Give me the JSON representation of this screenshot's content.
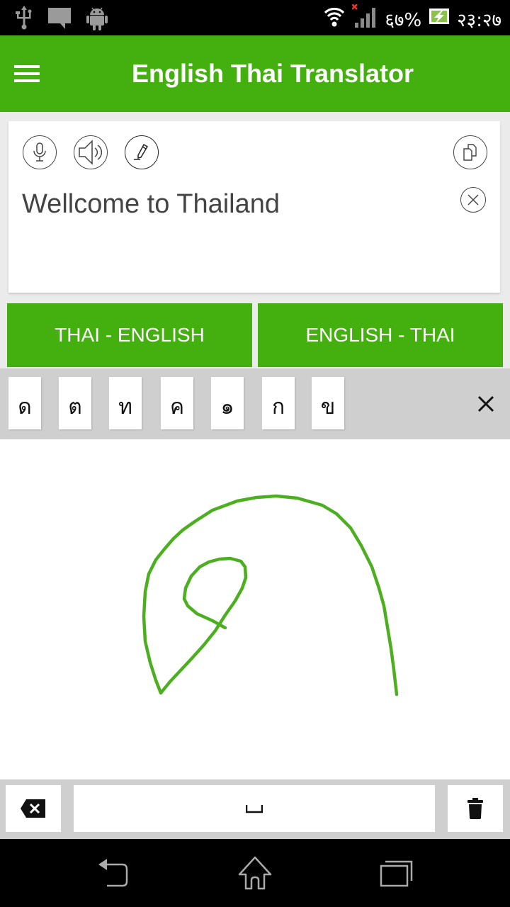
{
  "status_bar": {
    "battery_percent": "६७%",
    "time": "२३:२७",
    "icons": [
      "usb-icon",
      "message-icon",
      "android-icon",
      "wifi-icon",
      "signal-icon",
      "battery-charging-icon"
    ]
  },
  "app_bar": {
    "title": "English Thai Translator",
    "menu_icon": "hamburger-menu-icon"
  },
  "input": {
    "text": "Wellcome to Thailand",
    "actions": [
      "microphone-icon",
      "speaker-icon",
      "pencil-icon",
      "copy-icon",
      "clear-icon"
    ]
  },
  "direction_buttons": {
    "thai_english": "THAI - ENGLISH",
    "english_thai": "ENGLISH - THAI"
  },
  "handwriting": {
    "candidates": [
      "ด",
      "ต",
      "ท",
      "ค",
      "๑",
      "ก",
      "ข"
    ],
    "close_icon": "close-icon",
    "stroke_color": "#4caf1f"
  },
  "keyboard": {
    "space_label": "␣",
    "backspace_icon": "backspace-icon",
    "delete_icon": "trash-icon"
  },
  "colors": {
    "brand_green": "#43b00f",
    "status_bar": "#000000",
    "candidate_bar": "#cfcfcf"
  },
  "nav_bar": {
    "icons": [
      "back-icon",
      "home-icon",
      "recent-apps-icon"
    ]
  }
}
